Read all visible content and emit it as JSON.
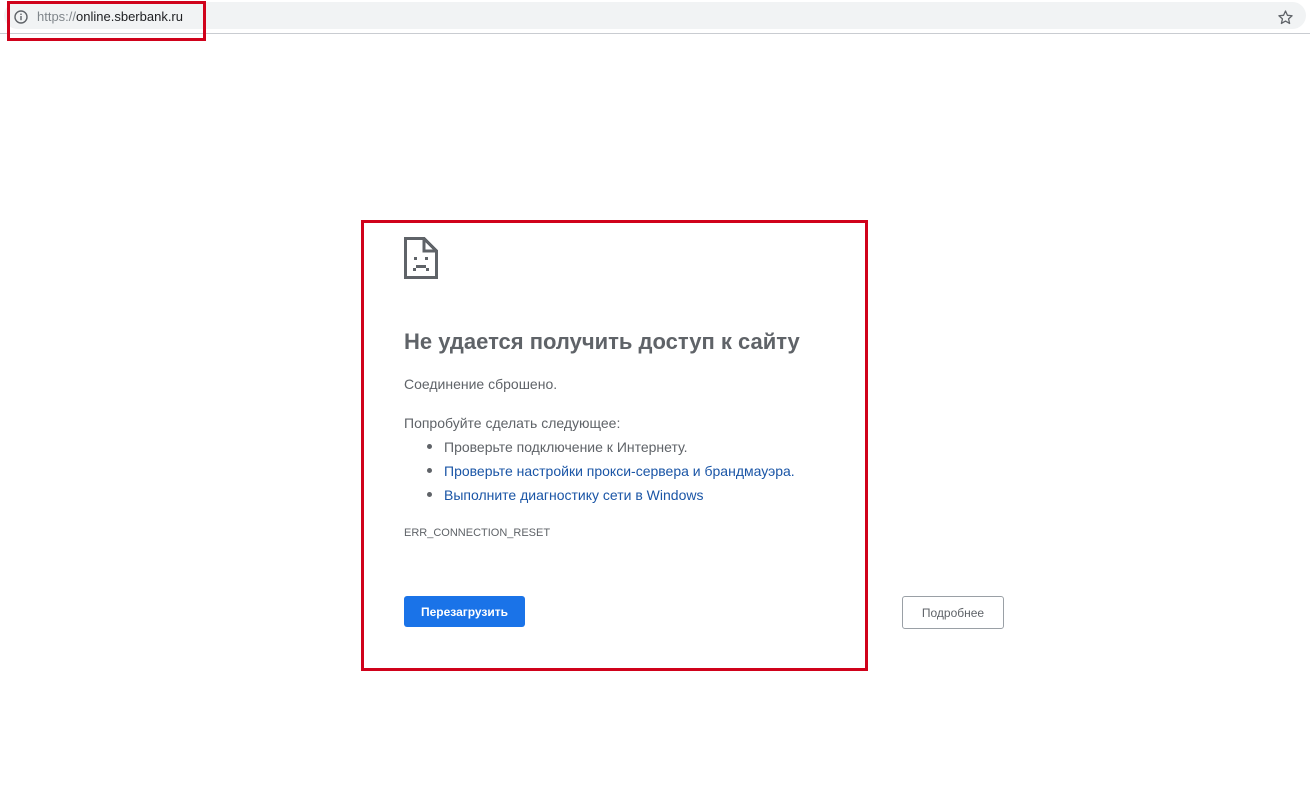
{
  "address_bar": {
    "url_scheme": "https://",
    "url_host": "online.sberbank.ru",
    "info_icon": "info-icon",
    "bookmark_icon": "star-icon"
  },
  "error_page": {
    "icon": "sad-document-icon",
    "title": "Не удается получить доступ к сайту",
    "subtitle": "Соединение сброшено.",
    "suggestions_heading": "Попробуйте сделать следующее:",
    "suggestions": [
      "Проверьте подключение к Интернету.",
      "Проверьте настройки прокси-сервера и брандмауэра.",
      "Выполните диагностику сети в Windows"
    ],
    "error_code": "ERR_CONNECTION_RESET",
    "reload_label": "Перезагрузить",
    "details_label": "Подробнее"
  },
  "colors": {
    "annotation": "#d0021b",
    "link": "#1a55a6",
    "primary_button": "#1a73e8",
    "text": "#5f6368"
  }
}
